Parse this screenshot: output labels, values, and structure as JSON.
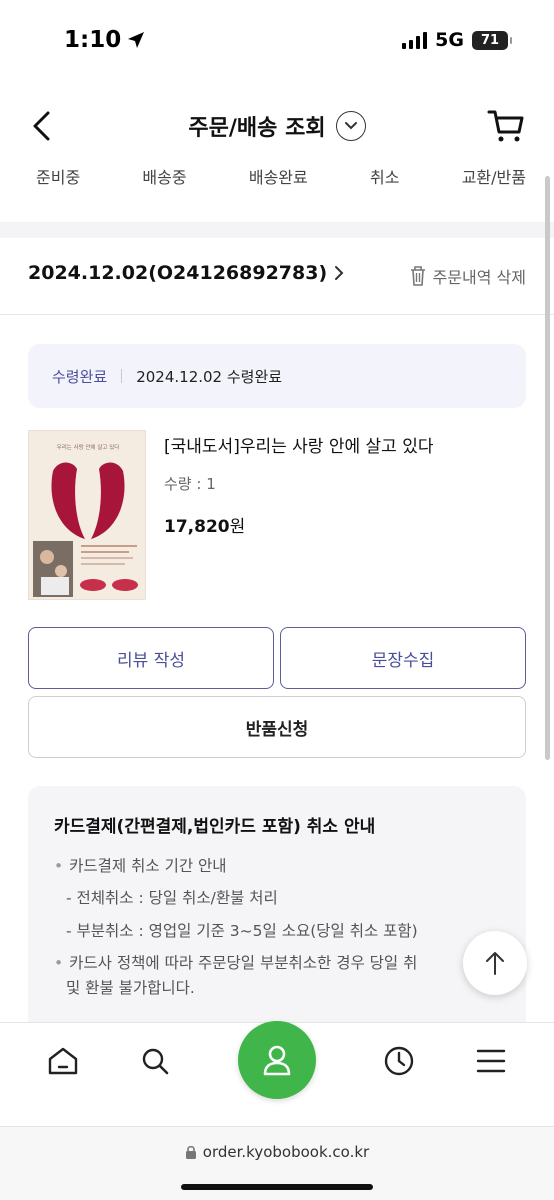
{
  "status_bar": {
    "time": "1:10",
    "network": "5G",
    "battery": "71"
  },
  "header": {
    "title": "주문/배송 조회"
  },
  "tabs": [
    {
      "label": "준비중"
    },
    {
      "label": "배송중"
    },
    {
      "label": "배송완료"
    },
    {
      "label": "취소"
    },
    {
      "label": "교환/반품"
    }
  ],
  "order": {
    "id": "2024.12.02(O24126892783)",
    "delete_label": "주문내역 삭제",
    "status_label": "수령완료",
    "status_text": "2024.12.02 수령완료"
  },
  "product": {
    "title": "[국내도서]우리는 사랑 안에 살고 있다",
    "quantity": "수량 : 1",
    "price": "17,820",
    "currency": "원",
    "cover_title": "우리는 사랑 안에 살고 있다"
  },
  "buttons": {
    "review": "리뷰 작성",
    "collect": "문장수집",
    "return": "반품신청"
  },
  "notice": {
    "title": "카드결제(간편결제,법인카드 포함) 취소 안내",
    "lines": [
      "카드결제 취소 기간 안내",
      "- 전체취소 : 당일 취소/환불 처리",
      "- 부분취소 : 영업일 기준 3~5일 소요(당일 취소 포함)",
      "카드사 정책에 따라 주문당일 부분취소한 경우 당일 취",
      "및 환불 불가합니다."
    ]
  },
  "browser": {
    "url": "order.kyobobook.co.kr"
  },
  "colors": {
    "accent": "#4b4f9a",
    "nav_center": "#3fb54a"
  }
}
